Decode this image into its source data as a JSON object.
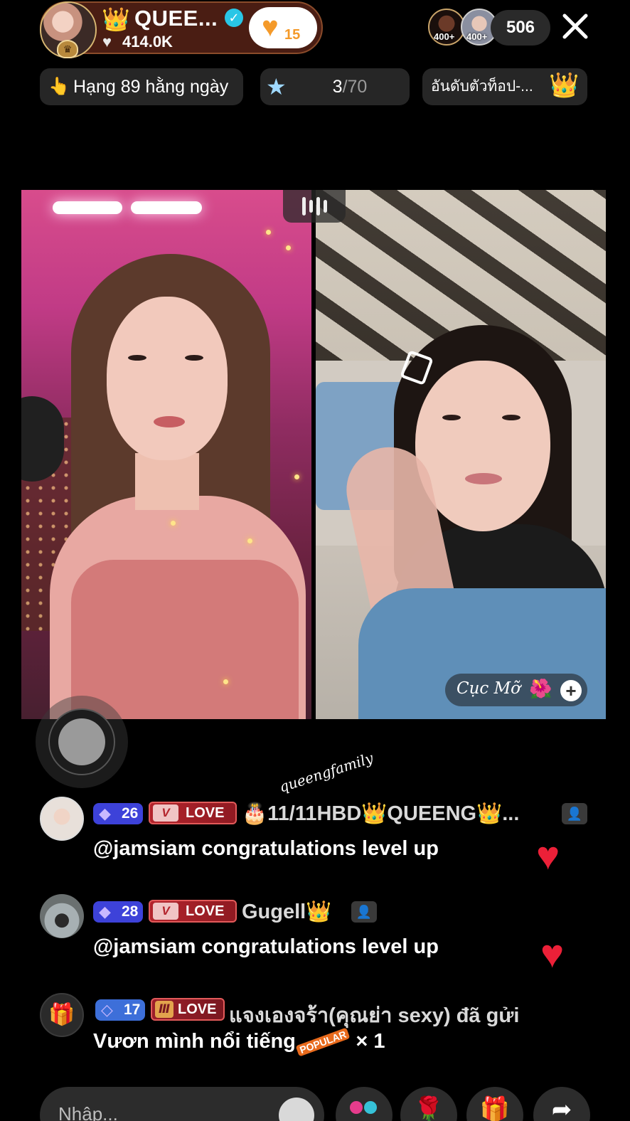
{
  "header": {
    "host_name": "QUEE...",
    "host_likes": "414.0K",
    "follow_count": "15",
    "viewer_badges": [
      "400+",
      "400+"
    ],
    "viewer_count": "506"
  },
  "info_pills": {
    "rank_label": "Hạng 89 hằng ngày",
    "progress_current": "3",
    "progress_total": "/70",
    "top_label": "อันดับตัวท็อป-..."
  },
  "video": {
    "guest_name": "Cục Mỡ",
    "guest_emoji": "🌺"
  },
  "watermark": "queengfamily",
  "chat": [
    {
      "level": "26",
      "badge": "LOVE",
      "name": "🎂11/11HBD👑QUEENG👑...",
      "message": "@jamsiam congratulations level up"
    },
    {
      "level": "28",
      "badge": "LOVE",
      "name": "Gugell👑",
      "message": "@jamsiam congratulations level up"
    },
    {
      "level": "17",
      "badge": "LOVE",
      "name": "แจงเองจร้า(คุณย่า sexy) đã gửi",
      "message_prefix": "Vươn mình nổi tiếng",
      "gift_tag": "POPULAR",
      "message_suffix": " × 1"
    }
  ],
  "bottom_bar": {
    "input_placeholder": "Nhập..."
  },
  "icons": {
    "close": "close-icon",
    "heart": "heart-icon",
    "gift": "gift-icon",
    "rose": "rose-icon",
    "share": "share-icon"
  },
  "colors": {
    "host_pill": "#4a1d13",
    "level_badge": "#3d42d9",
    "love_badge": "#b3242c",
    "heart": "#ec2038"
  }
}
